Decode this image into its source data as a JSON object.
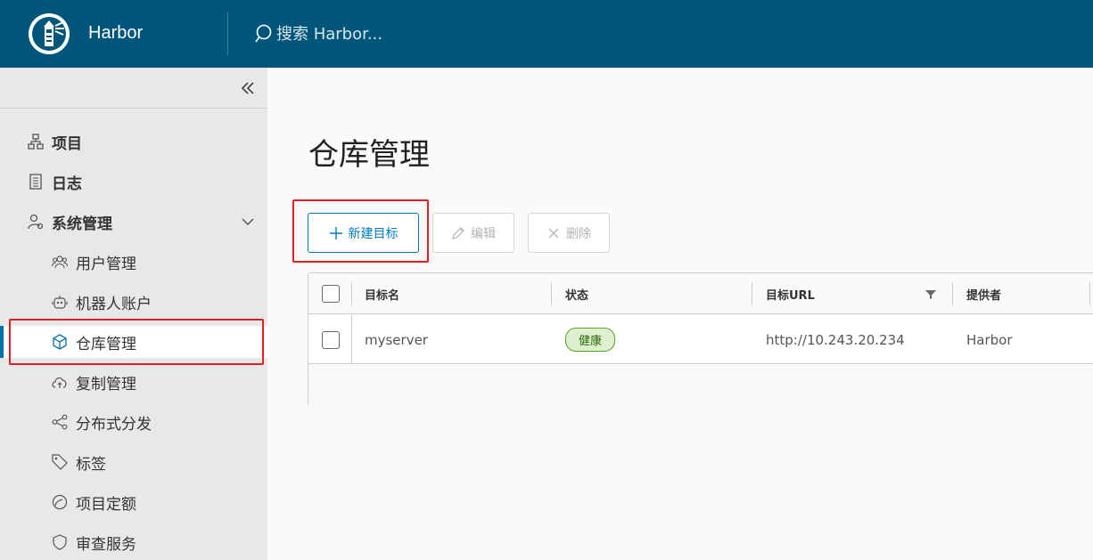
{
  "header": {
    "app_name": "Harbor",
    "search_placeholder": "搜索 Harbor..."
  },
  "sidebar": {
    "items": [
      {
        "label": "项目",
        "icon": "project-icon"
      },
      {
        "label": "日志",
        "icon": "log-icon"
      },
      {
        "label": "系统管理",
        "icon": "admin-icon"
      },
      {
        "label": "用户管理",
        "icon": "users-icon"
      },
      {
        "label": "机器人账户",
        "icon": "robot-icon"
      },
      {
        "label": "仓库管理",
        "icon": "registry-icon",
        "active": true
      },
      {
        "label": "复制管理",
        "icon": "replication-icon"
      },
      {
        "label": "分布式分发",
        "icon": "distribution-icon"
      },
      {
        "label": "标签",
        "icon": "tag-icon"
      },
      {
        "label": "项目定额",
        "icon": "quota-icon"
      },
      {
        "label": "审查服务",
        "icon": "shield-icon"
      }
    ]
  },
  "main": {
    "title": "仓库管理",
    "toolbar": {
      "new_label": "新建目标",
      "edit_label": "编辑",
      "delete_label": "删除"
    },
    "table": {
      "columns": [
        "目标名",
        "状态",
        "目标URL",
        "提供者"
      ],
      "rows": [
        {
          "name": "myserver",
          "status": "健康",
          "url": "http://10.243.20.234",
          "provider": "Harbor"
        }
      ]
    }
  },
  "colors": {
    "header_bg": "#00567a",
    "accent": "#0079b8",
    "highlight_box": "#e02020",
    "healthy_badge": "#dff0d0"
  }
}
